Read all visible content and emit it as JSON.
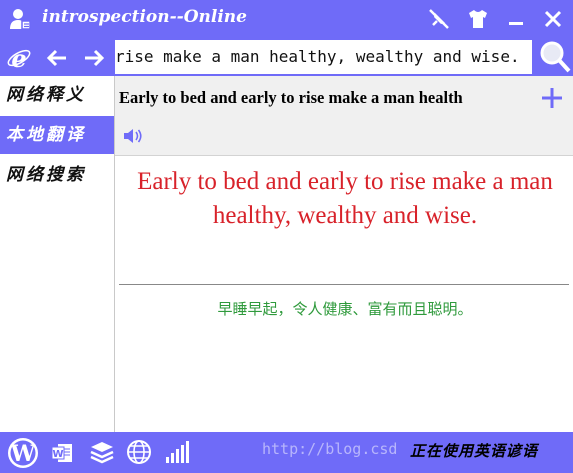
{
  "window": {
    "title": "introspection--Online"
  },
  "search": {
    "value": "rise make a man healthy, wealthy and wise."
  },
  "sidebar": {
    "items": [
      {
        "label": "网络释义"
      },
      {
        "label": "本地翻译"
      },
      {
        "label": "网络搜索"
      }
    ]
  },
  "main": {
    "headword": "Early to bed and early to rise make a man health",
    "english": "Early to bed and early to rise make a man healthy, wealthy and wise.",
    "chinese": "早睡早起，令人健康、富有而且聪明。"
  },
  "footer": {
    "watermark": "http://blog.csd",
    "status": "正在使用英语谚语"
  },
  "colors": {
    "accent": "#6f6bf8",
    "english_text": "#d8222a",
    "chinese_text": "#2f9a3c"
  },
  "icons": [
    "user-icon",
    "pin-icon",
    "shirt-icon",
    "minimize-icon",
    "close-icon",
    "ie-icon",
    "back-arrow-icon",
    "forward-arrow-icon",
    "search-icon",
    "plus-icon",
    "speaker-icon",
    "wordpress-icon",
    "word-icon",
    "layers-icon",
    "globe-icon",
    "signal-icon"
  ]
}
